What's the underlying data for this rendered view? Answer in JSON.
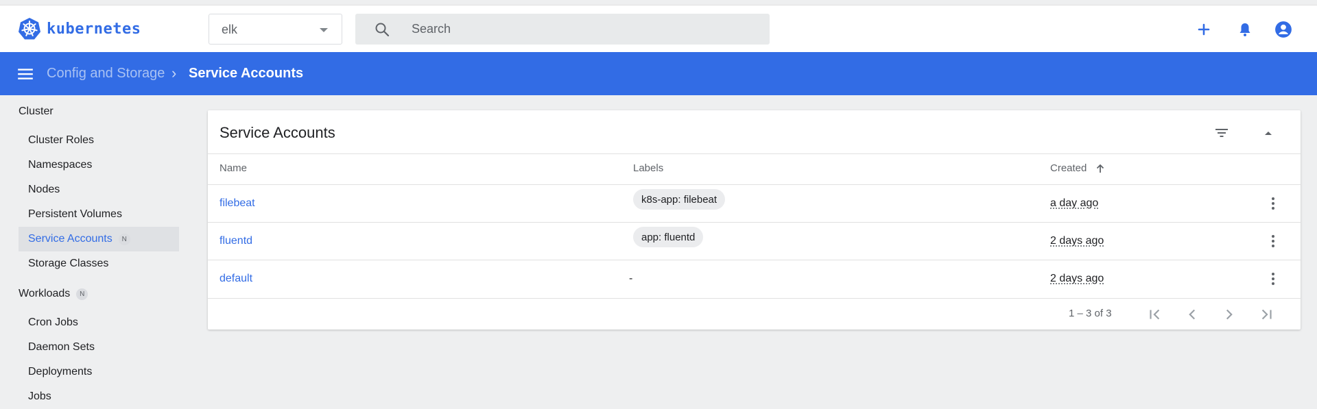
{
  "app": {
    "logo_text": "kubernetes",
    "brand_color": "#326ce5"
  },
  "topbar": {
    "namespace": "elk",
    "search_placeholder": "Search",
    "icons": [
      "add-icon",
      "bell-icon",
      "account-icon"
    ]
  },
  "breadcrumb": {
    "parent": "Config and Storage",
    "separator": "›",
    "current": "Service Accounts"
  },
  "sidebar": {
    "cluster_heading": "Cluster",
    "cluster_items": [
      {
        "label": "Cluster Roles"
      },
      {
        "label": "Namespaces"
      },
      {
        "label": "Nodes"
      },
      {
        "label": "Persistent Volumes"
      },
      {
        "label": "Service Accounts",
        "badge": "N",
        "active": true
      },
      {
        "label": "Storage Classes"
      }
    ],
    "workloads_heading": "Workloads",
    "workloads_badge": "N",
    "workload_items": [
      {
        "label": "Cron Jobs"
      },
      {
        "label": "Daemon Sets"
      },
      {
        "label": "Deployments"
      },
      {
        "label": "Jobs"
      }
    ]
  },
  "card": {
    "title": "Service Accounts",
    "columns": {
      "name": "Name",
      "labels": "Labels",
      "created": "Created"
    },
    "rows": [
      {
        "name": "filebeat",
        "label": "k8s-app: filebeat",
        "created": "a day ago"
      },
      {
        "name": "fluentd",
        "label": "app: fluentd",
        "created": "2 days ago"
      },
      {
        "name": "default",
        "label": "-",
        "created": "2 days ago"
      }
    ],
    "pagination": {
      "range": "1 – 3 of 3"
    }
  }
}
